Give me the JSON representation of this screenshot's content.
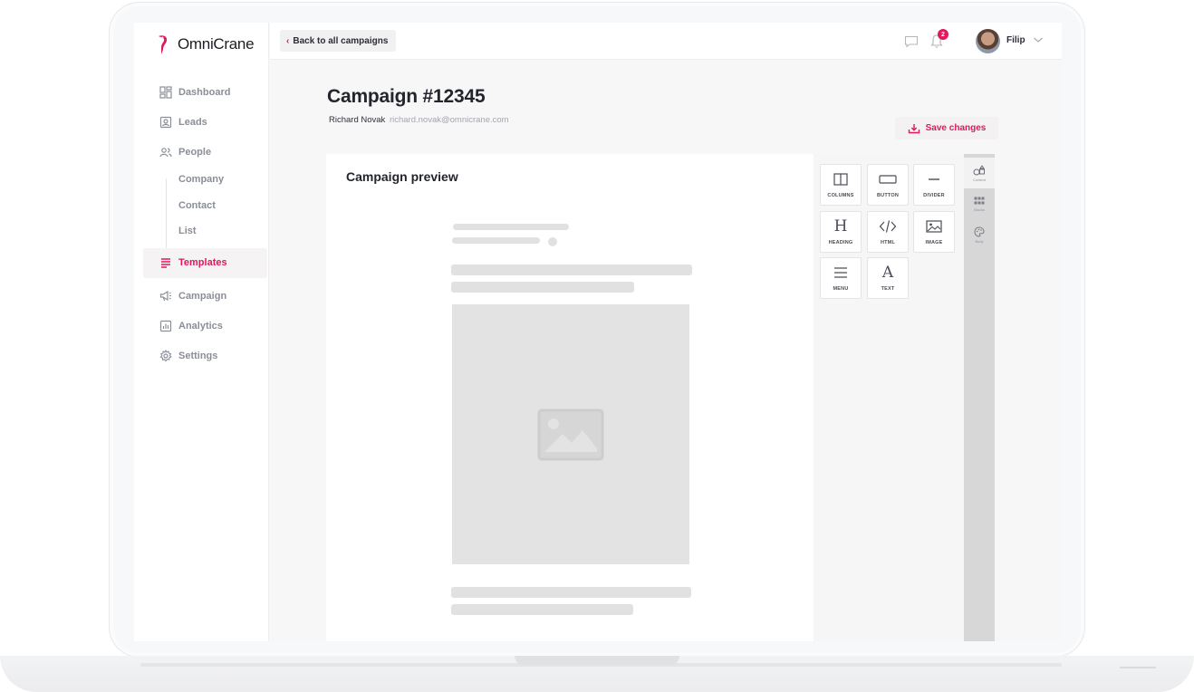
{
  "brand": {
    "name": "OmniCrane",
    "accent": "#e0195a"
  },
  "sidebar": {
    "items": [
      {
        "label": "Dashboard",
        "icon": "dashboard-icon"
      },
      {
        "label": "Leads",
        "icon": "leads-icon"
      },
      {
        "label": "People",
        "icon": "people-icon"
      },
      {
        "label": "Company",
        "icon": null
      },
      {
        "label": "Contact",
        "icon": null
      },
      {
        "label": "List",
        "icon": null
      },
      {
        "label": "Templates",
        "icon": "templates-icon",
        "active": true
      },
      {
        "label": "Campaign",
        "icon": "megaphone-icon"
      },
      {
        "label": "Analytics",
        "icon": "analytics-icon"
      },
      {
        "label": "Settings",
        "icon": "gear-icon"
      }
    ]
  },
  "topbar": {
    "back_label": "Back to all campaigns",
    "notifications_count": "2",
    "user_name": "Filip"
  },
  "campaign": {
    "title": "Campaign #12345",
    "owner_name": "Richard Novak",
    "owner_email": "richard.novak@omnicrane.com",
    "save_label": "Save changes"
  },
  "editor": {
    "preview_title": "Campaign preview",
    "tools": [
      {
        "label": "COLUMNS",
        "icon": "columns-icon"
      },
      {
        "label": "BUTTON",
        "icon": "button-icon"
      },
      {
        "label": "DIVIDER",
        "icon": "divider-icon"
      },
      {
        "label": "HEADING",
        "icon": "heading-icon"
      },
      {
        "label": "HTML",
        "icon": "code-icon"
      },
      {
        "label": "IMAGE",
        "icon": "image-icon"
      },
      {
        "label": "MENU",
        "icon": "menu-icon"
      },
      {
        "label": "TEXT",
        "icon": "text-icon"
      }
    ],
    "rail_tabs": [
      {
        "label": "Content",
        "icon": "shapes-icon"
      },
      {
        "label": "Blocks",
        "icon": "blocks-icon"
      },
      {
        "label": "Body",
        "icon": "palette-icon"
      }
    ]
  }
}
